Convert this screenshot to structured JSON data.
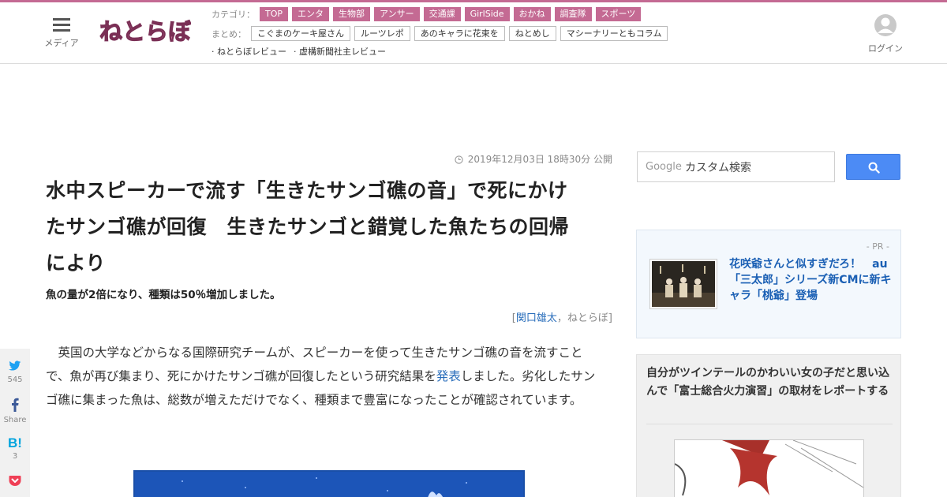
{
  "header": {
    "menu_label": "メディア",
    "logo_text": "ねとらぼ",
    "categories_label": "カテゴリ：",
    "categories": [
      "TOP",
      "エンタ",
      "生物部",
      "アンサー",
      "交通課",
      "GirlSide",
      "おかね",
      "調査隊",
      "スポーツ"
    ],
    "matome_label": "まとめ：",
    "matome": [
      "こぐまのケーキ屋さん",
      "ルーツレポ",
      "あのキャラに花束を",
      "ねとめし",
      "マシーナリーともコラム"
    ],
    "extra_links": [
      "· ねとらぼレビュー",
      "· 虚構新聞社主レビュー"
    ],
    "login_label": "ログイン",
    "brand_color": "#c46a93"
  },
  "article": {
    "published": "2019年12月03日 18時30分 公開",
    "title_lines": [
      "水中スピーカーで流す「生きたサンゴ礁の音」で死にかけ",
      "たサンゴ礁が回復　生きたサンゴと錯覚した魚たちの回帰",
      "により"
    ],
    "subtitle": "魚の量が2倍になり、種類は50％増加しました。",
    "byline_open": "[",
    "author": "関口雄太",
    "byline_sep": "，",
    "site": "ねとらぼ",
    "byline_close": "]",
    "body_before_link": "英国の大学などからなる国際研究チームが、スピーカーを使って生きたサンゴ礁の音を流すことで、魚が再び集まり、死にかけたサンゴ礁が回復したという研究結果を",
    "body_link": "発表",
    "body_after_link": "しました。劣化したサンゴ礁に集まった魚は、総数が増えただけでなく、種類まで豊富になったことが確認されています。"
  },
  "share": {
    "twitter_count": "545",
    "facebook_label": "Share",
    "hatena_icon_text": "B!",
    "hatena_count": "3"
  },
  "sidebar": {
    "search_brand": "Google",
    "search_placeholder": "カスタム検索",
    "pr_label": "- PR -",
    "pr_text": "花咲爺さんと似すぎだろ！　au「三太郎」シリーズ新CMに新キャラ「桃爺」登場",
    "ranking_title": "自分がツインテールのかわいい女の子だと思い込んで「富士総合火力演習」の取材をレポートする"
  }
}
